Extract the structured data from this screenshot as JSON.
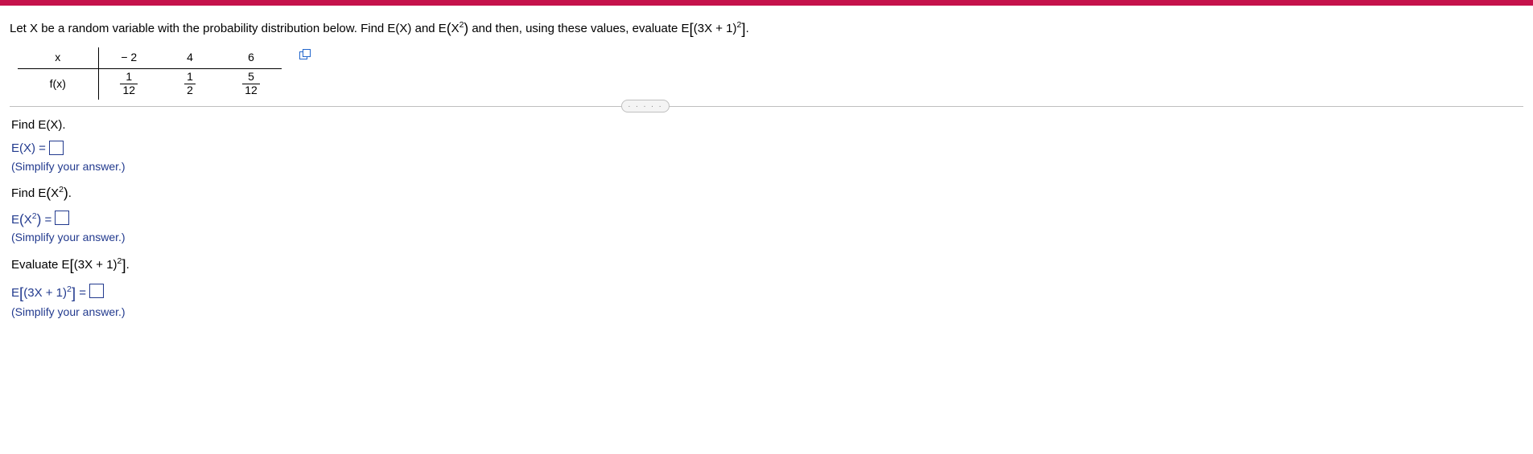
{
  "question": {
    "intro_1": "Let X be a random variable with the probability distribution below. Find E(X) and E",
    "intro_paren_open": "(",
    "intro_x2_base": "X",
    "intro_x2_exp": "2",
    "intro_paren_close": ")",
    "intro_2": " and then, using these values, evaluate E",
    "intro_br_open": "[",
    "intro_inner_1": "(3X + 1)",
    "intro_inner_exp": "2",
    "intro_br_close": "]",
    "intro_period": "."
  },
  "table": {
    "row1_label": "x",
    "row2_label": "f(x)",
    "x": [
      "− 2",
      "4",
      "6"
    ],
    "f_num": [
      "1",
      "1",
      "5"
    ],
    "f_den": [
      "12",
      "2",
      "12"
    ]
  },
  "divider_dots": ". . . . .",
  "steps": {
    "s1": {
      "prompt": "Find E(X).",
      "lhs": "E(X) =",
      "hint": "(Simplify your answer.)"
    },
    "s2": {
      "prompt_pre": "Find E",
      "prompt_po": "(",
      "prompt_base": "X",
      "prompt_exp": "2",
      "prompt_pc": ")",
      "prompt_post": ".",
      "lhs_pre": "E",
      "lhs_po": "(",
      "lhs_base": "X",
      "lhs_exp": "2",
      "lhs_pc": ")",
      "lhs_post": " =",
      "hint": "(Simplify your answer.)"
    },
    "s3": {
      "prompt_pre": "Evaluate E",
      "prompt_bo": "[",
      "prompt_inner": "(3X + 1)",
      "prompt_exp": "2",
      "prompt_bc": "]",
      "prompt_post": ".",
      "lhs_pre": "E",
      "lhs_bo": "[",
      "lhs_inner": "(3X + 1)",
      "lhs_exp": "2",
      "lhs_bc": "]",
      "lhs_post": " =",
      "hint": "(Simplify your answer.)"
    }
  }
}
